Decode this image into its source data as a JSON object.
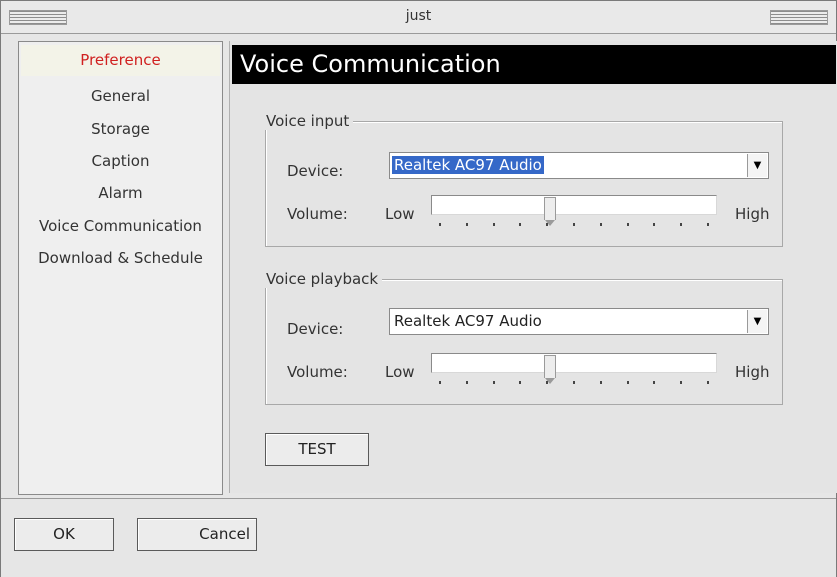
{
  "window": {
    "title": "just"
  },
  "sidebar": {
    "items": [
      {
        "label": "Preference",
        "active": true
      },
      {
        "label": "General"
      },
      {
        "label": "Storage"
      },
      {
        "label": "Caption"
      },
      {
        "label": "Alarm"
      },
      {
        "label": "Voice Communication"
      },
      {
        "label": "Download & Schedule"
      }
    ]
  },
  "content": {
    "header": "Voice Communication",
    "voice_input": {
      "legend": "Voice input",
      "device_label": "Device:",
      "device_value": "Realtek AC97 Audio",
      "volume_label": "Volume:",
      "volume_low": "Low",
      "volume_high": "High",
      "volume_level": 0.41
    },
    "voice_playback": {
      "legend": "Voice playback",
      "device_label": "Device:",
      "device_value": "Realtek AC97 Audio",
      "volume_label": "Volume:",
      "volume_low": "Low",
      "volume_high": "High",
      "volume_level": 0.41
    },
    "test_label": "TEST"
  },
  "buttons": {
    "ok": "OK",
    "cancel": "Cancel"
  },
  "colors": {
    "active_item": "#d02020",
    "selection": "#3568c8",
    "header_bg": "#000000"
  }
}
